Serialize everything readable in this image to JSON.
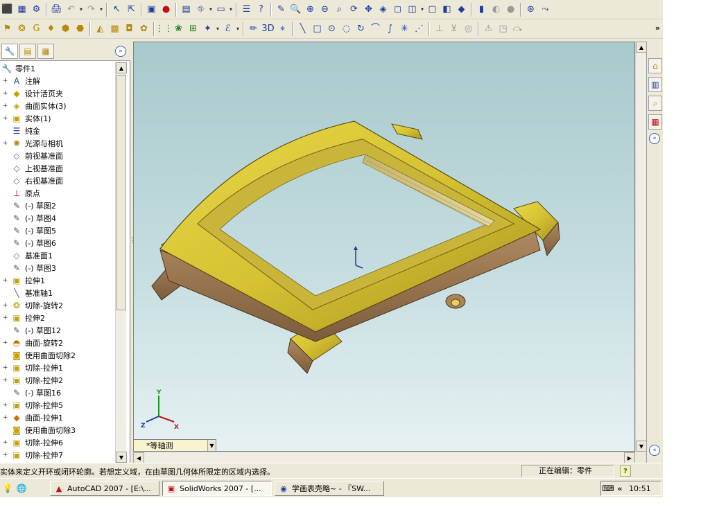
{
  "colors": {
    "model_face": "#d6c232",
    "model_side": "#9a7650",
    "accent": "#3060c0"
  },
  "toolbar1": [
    {
      "icon": "⬛",
      "name": "properties-icon"
    },
    {
      "icon": "▦",
      "name": "grid-icon"
    },
    {
      "icon": "⚙",
      "name": "options-icon"
    },
    {
      "icon": "🖨",
      "name": "print-icon"
    },
    {
      "icon": "↶",
      "name": "undo-icon"
    },
    {
      "icon": "↷",
      "name": "redo-icon"
    },
    {
      "icon": "↖",
      "name": "select-icon"
    },
    {
      "icon": "⇱",
      "name": "select-other-icon"
    },
    {
      "icon": "▣",
      "name": "rebuild-icon"
    },
    {
      "icon": "●",
      "name": "traffic-light-icon"
    },
    {
      "icon": "▤",
      "name": "file-props-icon"
    },
    {
      "icon": "⛗",
      "name": "tile-icon"
    },
    {
      "icon": "▭",
      "name": "window-icon"
    },
    {
      "icon": "☰",
      "name": "list-icon"
    },
    {
      "icon": "?",
      "name": "help-icon"
    },
    {
      "icon": "✎",
      "name": "sketch-pencil-icon"
    },
    {
      "icon": "🔍",
      "name": "zoom-fit-icon"
    },
    {
      "icon": "⊕",
      "name": "zoom-area-icon"
    },
    {
      "icon": "⊖",
      "name": "zoom-inout-icon"
    },
    {
      "icon": "⌕",
      "name": "zoom-select-icon"
    },
    {
      "icon": "⟳",
      "name": "rotate-icon"
    },
    {
      "icon": "✥",
      "name": "pan-icon"
    },
    {
      "icon": "◈",
      "name": "view-orient-icon"
    },
    {
      "icon": "◻",
      "name": "wireframe-icon"
    },
    {
      "icon": "◫",
      "name": "hidden-gray-icon"
    },
    {
      "icon": "▢",
      "name": "hidden-removed-icon"
    },
    {
      "icon": "◧",
      "name": "shaded-edges-icon"
    },
    {
      "icon": "◆",
      "name": "shaded-icon"
    },
    {
      "icon": "▮",
      "name": "shadow-icon"
    },
    {
      "icon": "◐",
      "name": "section-icon"
    },
    {
      "icon": "●",
      "name": "realview-icon"
    },
    {
      "icon": "⊛",
      "name": "dims-icon"
    },
    {
      "icon": "⤳",
      "name": "link-icon"
    }
  ],
  "toolbar2": [
    {
      "icon": "⚑",
      "name": "extrude-boss-icon"
    },
    {
      "icon": "❂",
      "name": "revolve-boss-icon"
    },
    {
      "icon": "G",
      "name": "sweep-icon"
    },
    {
      "icon": "♦",
      "name": "loft-icon"
    },
    {
      "icon": "⬢",
      "name": "extrude-cut-icon"
    },
    {
      "icon": "⬣",
      "name": "revolve-cut-icon"
    },
    {
      "icon": "◭",
      "name": "fillet-icon"
    },
    {
      "icon": "▩",
      "name": "chamfer-icon"
    },
    {
      "icon": "◘",
      "name": "shell-icon"
    },
    {
      "icon": "✿",
      "name": "rib-icon"
    },
    {
      "icon": "⋮⋮",
      "name": "pattern-icon"
    },
    {
      "icon": "❀",
      "name": "mirror-icon"
    },
    {
      "icon": "⊞",
      "name": "hole-icon"
    },
    {
      "icon": "✦",
      "name": "ref-geometry-icon"
    },
    {
      "icon": "ℰ",
      "name": "curves-icon"
    },
    {
      "icon": "✏",
      "name": "sketch-icon"
    },
    {
      "icon": "3D",
      "name": "sketch-3d-icon"
    },
    {
      "icon": "⌖",
      "name": "smart-dim-icon"
    },
    {
      "icon": "╲",
      "name": "line-icon"
    },
    {
      "icon": "□",
      "name": "rectangle-icon"
    },
    {
      "icon": "⊙",
      "name": "circle-icon"
    },
    {
      "icon": "◌",
      "name": "arc-icon"
    },
    {
      "icon": "↻",
      "name": "tangent-arc-icon"
    },
    {
      "icon": "⌒",
      "name": "three-point-arc-icon"
    },
    {
      "icon": "∫",
      "name": "spline-icon"
    },
    {
      "icon": "✳",
      "name": "point-icon"
    },
    {
      "icon": "⋰",
      "name": "centerline-icon"
    },
    {
      "icon": "⊥",
      "name": "relation-icon"
    },
    {
      "icon": "⊻",
      "name": "trim-icon"
    },
    {
      "icon": "◎",
      "name": "offset-icon"
    },
    {
      "icon": "⚠",
      "name": "display-delete-icon"
    },
    {
      "icon": "◳",
      "name": "convert-icon"
    },
    {
      "icon": "⤼",
      "name": "move-icon"
    }
  ],
  "panel_tabs": [
    {
      "icon": "🔧",
      "name": "feature-manager-tab"
    },
    {
      "icon": "▤",
      "name": "property-manager-tab"
    },
    {
      "icon": "▦",
      "name": "config-manager-tab"
    }
  ],
  "tree": [
    {
      "label": "零件1",
      "icon": "🔧",
      "exp": "",
      "root": true,
      "color": "#b8860b"
    },
    {
      "label": "注解",
      "icon": "A",
      "exp": "+",
      "color": "#1e3c9c"
    },
    {
      "label": "设计活页夹",
      "icon": "◆",
      "exp": "+",
      "color": "#c8a000"
    },
    {
      "label": "曲面实体(3)",
      "icon": "◈",
      "exp": "+",
      "color": "#c8a000"
    },
    {
      "label": "实体(1)",
      "icon": "▣",
      "exp": "+",
      "color": "#c8a000"
    },
    {
      "label": "纯金",
      "icon": "☰",
      "exp": "",
      "color": "#1e3c9c"
    },
    {
      "label": "光源与相机",
      "icon": "✺",
      "exp": "+",
      "color": "#b8860b"
    },
    {
      "label": "前视基准面",
      "icon": "◇",
      "exp": "",
      "color": "#666666"
    },
    {
      "label": "上视基准面",
      "icon": "◇",
      "exp": "",
      "color": "#666666"
    },
    {
      "label": "右视基准面",
      "icon": "◇",
      "exp": "",
      "color": "#666666"
    },
    {
      "label": "原点",
      "icon": "⊥",
      "exp": "",
      "color": "#c01010"
    },
    {
      "label": "(-) 草图2",
      "icon": "✎",
      "exp": "",
      "color": "#555555"
    },
    {
      "label": "(-) 草图4",
      "icon": "✎",
      "exp": "",
      "color": "#555555"
    },
    {
      "label": "(-) 草图5",
      "icon": "✎",
      "exp": "",
      "color": "#555555"
    },
    {
      "label": "(-) 草图6",
      "icon": "✎",
      "exp": "",
      "color": "#555555"
    },
    {
      "label": "基准面1",
      "icon": "◇",
      "exp": "",
      "color": "#666666"
    },
    {
      "label": "(-) 草图3",
      "icon": "✎",
      "exp": "",
      "color": "#555555"
    },
    {
      "label": "拉伸1",
      "icon": "▣",
      "exp": "+",
      "color": "#c8a000"
    },
    {
      "label": "基准轴1",
      "icon": "╲",
      "exp": "",
      "color": "#555555"
    },
    {
      "label": "切除-旋转2",
      "icon": "❂",
      "exp": "+",
      "color": "#c8a000"
    },
    {
      "label": "拉伸2",
      "icon": "▣",
      "exp": "+",
      "color": "#c8a000"
    },
    {
      "label": "(-) 草图12",
      "icon": "✎",
      "exp": "",
      "color": "#555555"
    },
    {
      "label": "曲面-旋转2",
      "icon": "◓",
      "exp": "+",
      "color": "#c87000"
    },
    {
      "label": "使用曲面切除2",
      "icon": "◙",
      "exp": "",
      "color": "#c8a000"
    },
    {
      "label": "切除-拉伸1",
      "icon": "▣",
      "exp": "+",
      "color": "#c8a000"
    },
    {
      "label": "切除-拉伸2",
      "icon": "▣",
      "exp": "+",
      "color": "#c8a000"
    },
    {
      "label": "(-) 草图16",
      "icon": "✎",
      "exp": "",
      "color": "#555555"
    },
    {
      "label": "切除-拉伸5",
      "icon": "▣",
      "exp": "+",
      "color": "#c8a000"
    },
    {
      "label": "曲面-拉伸1",
      "icon": "◆",
      "exp": "+",
      "color": "#c87000"
    },
    {
      "label": "使用曲面切除3",
      "icon": "◙",
      "exp": "",
      "color": "#c8a000"
    },
    {
      "label": "切除-拉伸6",
      "icon": "▣",
      "exp": "+",
      "color": "#c8a000"
    },
    {
      "label": "切除-拉伸7",
      "icon": "▣",
      "exp": "+",
      "color": "#c8a000"
    }
  ],
  "viewport": {
    "view_name": "*等轴测",
    "triad_labels": {
      "x": "X",
      "y": "Y",
      "z": "Z"
    }
  },
  "taskpane": [
    {
      "icon": "⌂",
      "name": "home-icon",
      "color": "#b8860b"
    },
    {
      "icon": "▥",
      "name": "library-icon",
      "color": "#1e3c9c"
    },
    {
      "icon": "⌕",
      "name": "search-files-icon",
      "color": "#b8860b"
    },
    {
      "icon": "▦",
      "name": "appearance-icon",
      "color": "#c01010"
    }
  ],
  "status": {
    "message": "实体来定义开环或闭环轮廓。若想定义域，在由草图几何体所限定的区域内选择。",
    "editing": "正在编辑：零件",
    "help": "?"
  },
  "taskbar": {
    "quick": [
      {
        "icon": "💡",
        "name": "quick-launch-bulb-icon"
      },
      {
        "icon": "🌐",
        "name": "quick-launch-ie-icon"
      }
    ],
    "buttons": [
      {
        "label": "AutoCAD 2007 - [E:\\...",
        "icon": "▲",
        "color": "#c01010",
        "active": false
      },
      {
        "label": "SolidWorks 2007 - [...",
        "icon": "▣",
        "color": "#c01010",
        "active": true
      },
      {
        "label": "学画表壳略~ - 『SW...",
        "icon": "◉",
        "color": "#1e3c9c",
        "active": false
      }
    ],
    "clock": "10:51",
    "expand": "«"
  },
  "ui": {
    "panel_collapse": "»",
    "toolbar_more": "»",
    "taskpane_collapse": "«",
    "scroll_up": "▲",
    "scroll_down": "▼",
    "scroll_left": "◀",
    "scroll_right": "▶",
    "combo_arrow": "▼",
    "grip": "⋮"
  }
}
